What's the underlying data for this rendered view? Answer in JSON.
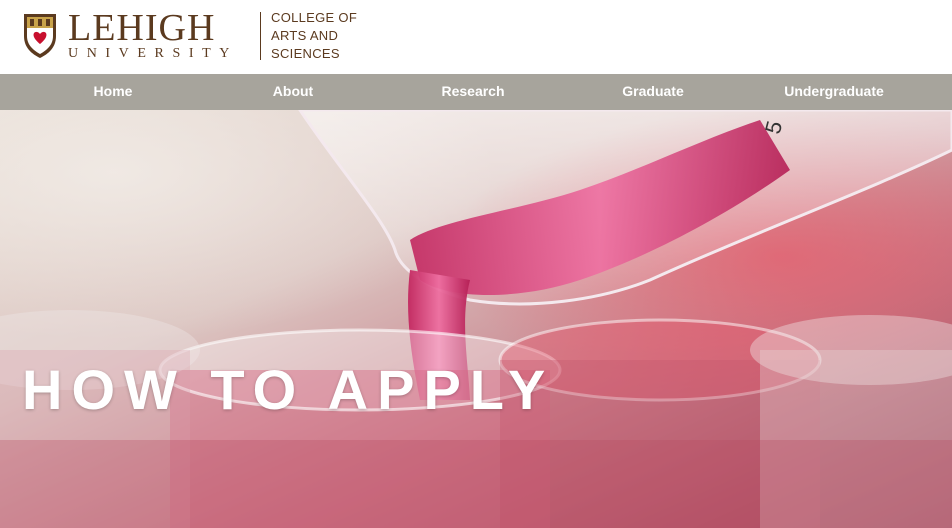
{
  "logo": {
    "name_top": "LEHIGH",
    "name_bottom": "UNIVERSITY",
    "college": "COLLEGE OF\nARTS AND\nSCIENCES"
  },
  "nav": {
    "items": [
      {
        "label": "Home"
      },
      {
        "label": "About"
      },
      {
        "label": "Research"
      },
      {
        "label": "Graduate"
      },
      {
        "label": "Undergraduate"
      }
    ]
  },
  "hero": {
    "title": "HOW TO APPLY",
    "image_subject": "pink liquid being poured from a beaker into lab dishes"
  },
  "colors": {
    "brand_brown": "#5b3a1f",
    "nav_bg": "#a7a49c",
    "hero_pink": "#d8427a"
  }
}
